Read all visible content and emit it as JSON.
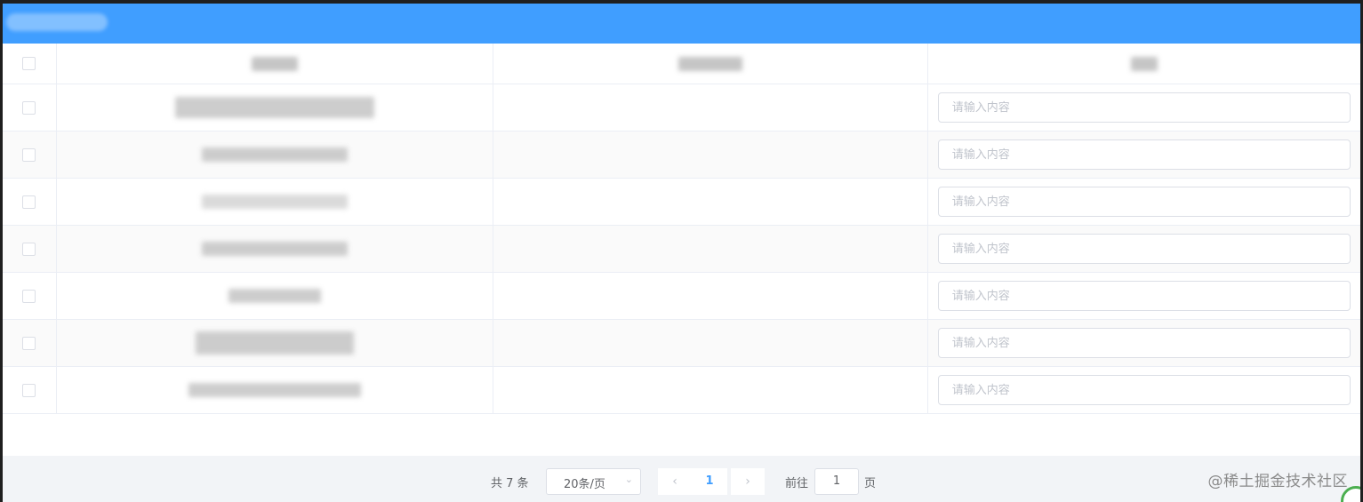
{
  "table": {
    "rows": [
      {
        "placeholder": "请输入内容",
        "value": ""
      },
      {
        "placeholder": "请输入内容",
        "value": ""
      },
      {
        "placeholder": "请输入内容",
        "value": ""
      },
      {
        "placeholder": "请输入内容",
        "value": ""
      },
      {
        "placeholder": "请输入内容",
        "value": ""
      },
      {
        "placeholder": "请输入内容",
        "value": ""
      },
      {
        "placeholder": "请输入内容",
        "value": ""
      }
    ]
  },
  "pagination": {
    "total_label": "共 7 条",
    "page_size": "20条/页",
    "prev_icon": "chevron-left-icon",
    "current_page": "1",
    "next_icon": "chevron-right-icon",
    "goto_prefix": "前往",
    "goto_value": "1",
    "goto_suffix": "页"
  },
  "watermark": "@稀土掘金技术社区",
  "colors": {
    "header_bar": "#409eff",
    "active_page": "#409eff",
    "border": "#ebeef5",
    "footer_bg": "#f2f4f7"
  }
}
